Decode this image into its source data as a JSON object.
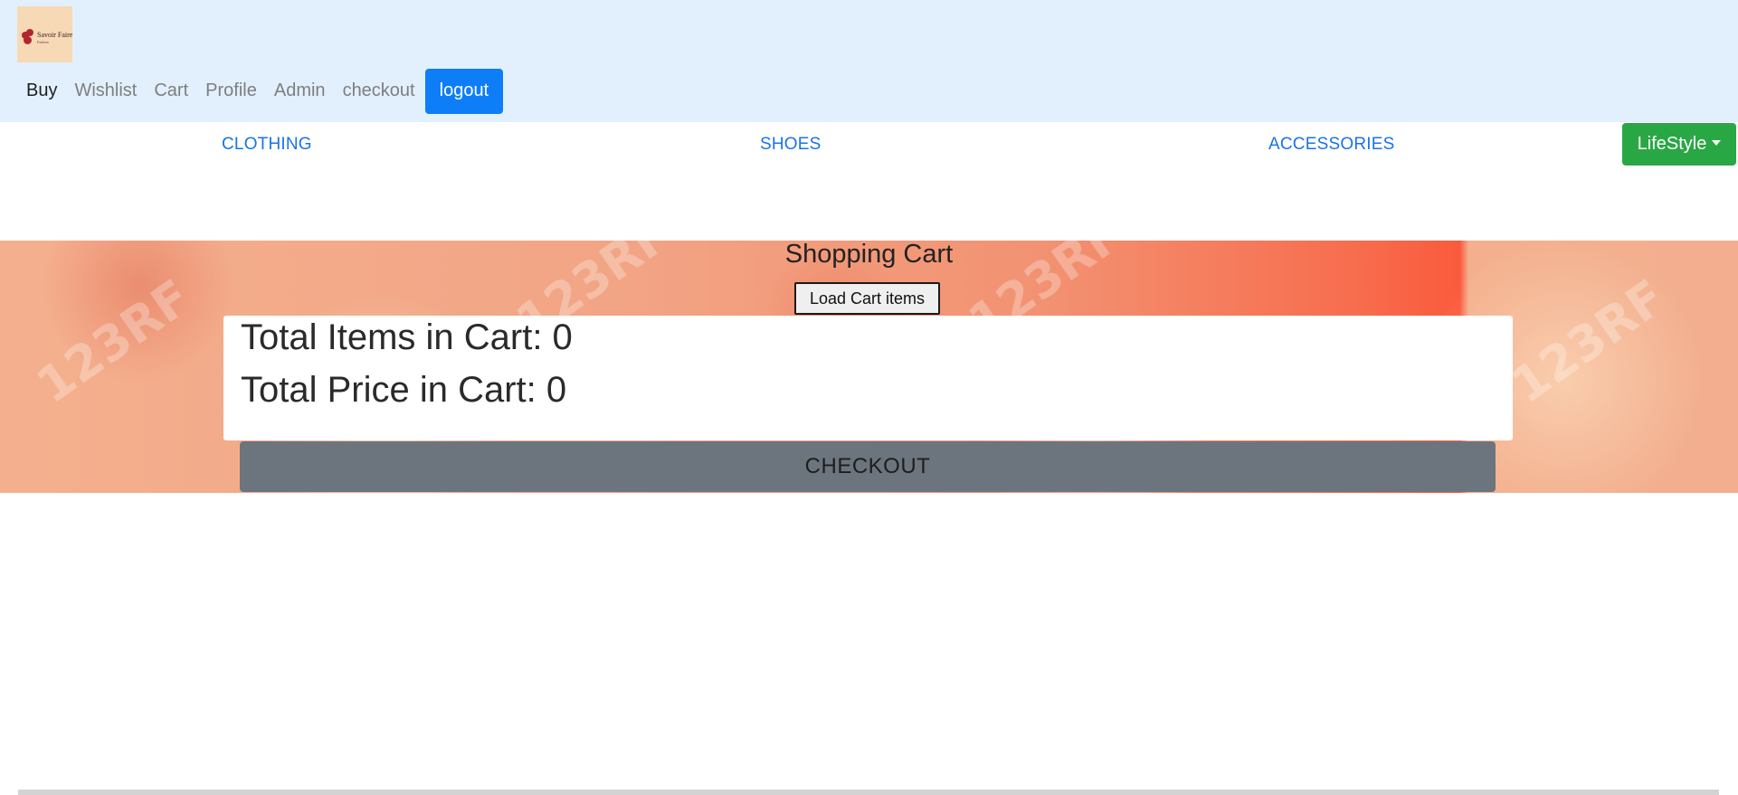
{
  "header": {
    "logo": {
      "brand": "Savoir Faire",
      "tagline": "Fashion"
    },
    "nav": {
      "items": [
        {
          "label": "Buy",
          "active": true
        },
        {
          "label": "Wishlist",
          "active": false
        },
        {
          "label": "Cart",
          "active": false
        },
        {
          "label": "Profile",
          "active": false
        },
        {
          "label": "Admin",
          "active": false
        },
        {
          "label": "checkout",
          "active": false
        }
      ],
      "logout_label": "logout"
    }
  },
  "categories": {
    "items": [
      "CLOTHING",
      "SHOES",
      "ACCESSORIES"
    ],
    "dropdown_label": "LifeStyle"
  },
  "cart": {
    "title": "Shopping Cart",
    "load_button_label": "Load Cart items",
    "total_items_text": "Total Items in Cart: 0",
    "total_price_text": "Total Price in Cart: 0",
    "checkout_label": "CHECKOUT",
    "banner_watermark": "123RF"
  },
  "colors": {
    "header_bg": "#e2f0fd",
    "primary": "#0d7ef8",
    "success": "#29a745",
    "secondary": "#6c757e",
    "link": "#1a73e8"
  },
  "icons": {
    "dropdown": "caret-down-icon"
  }
}
